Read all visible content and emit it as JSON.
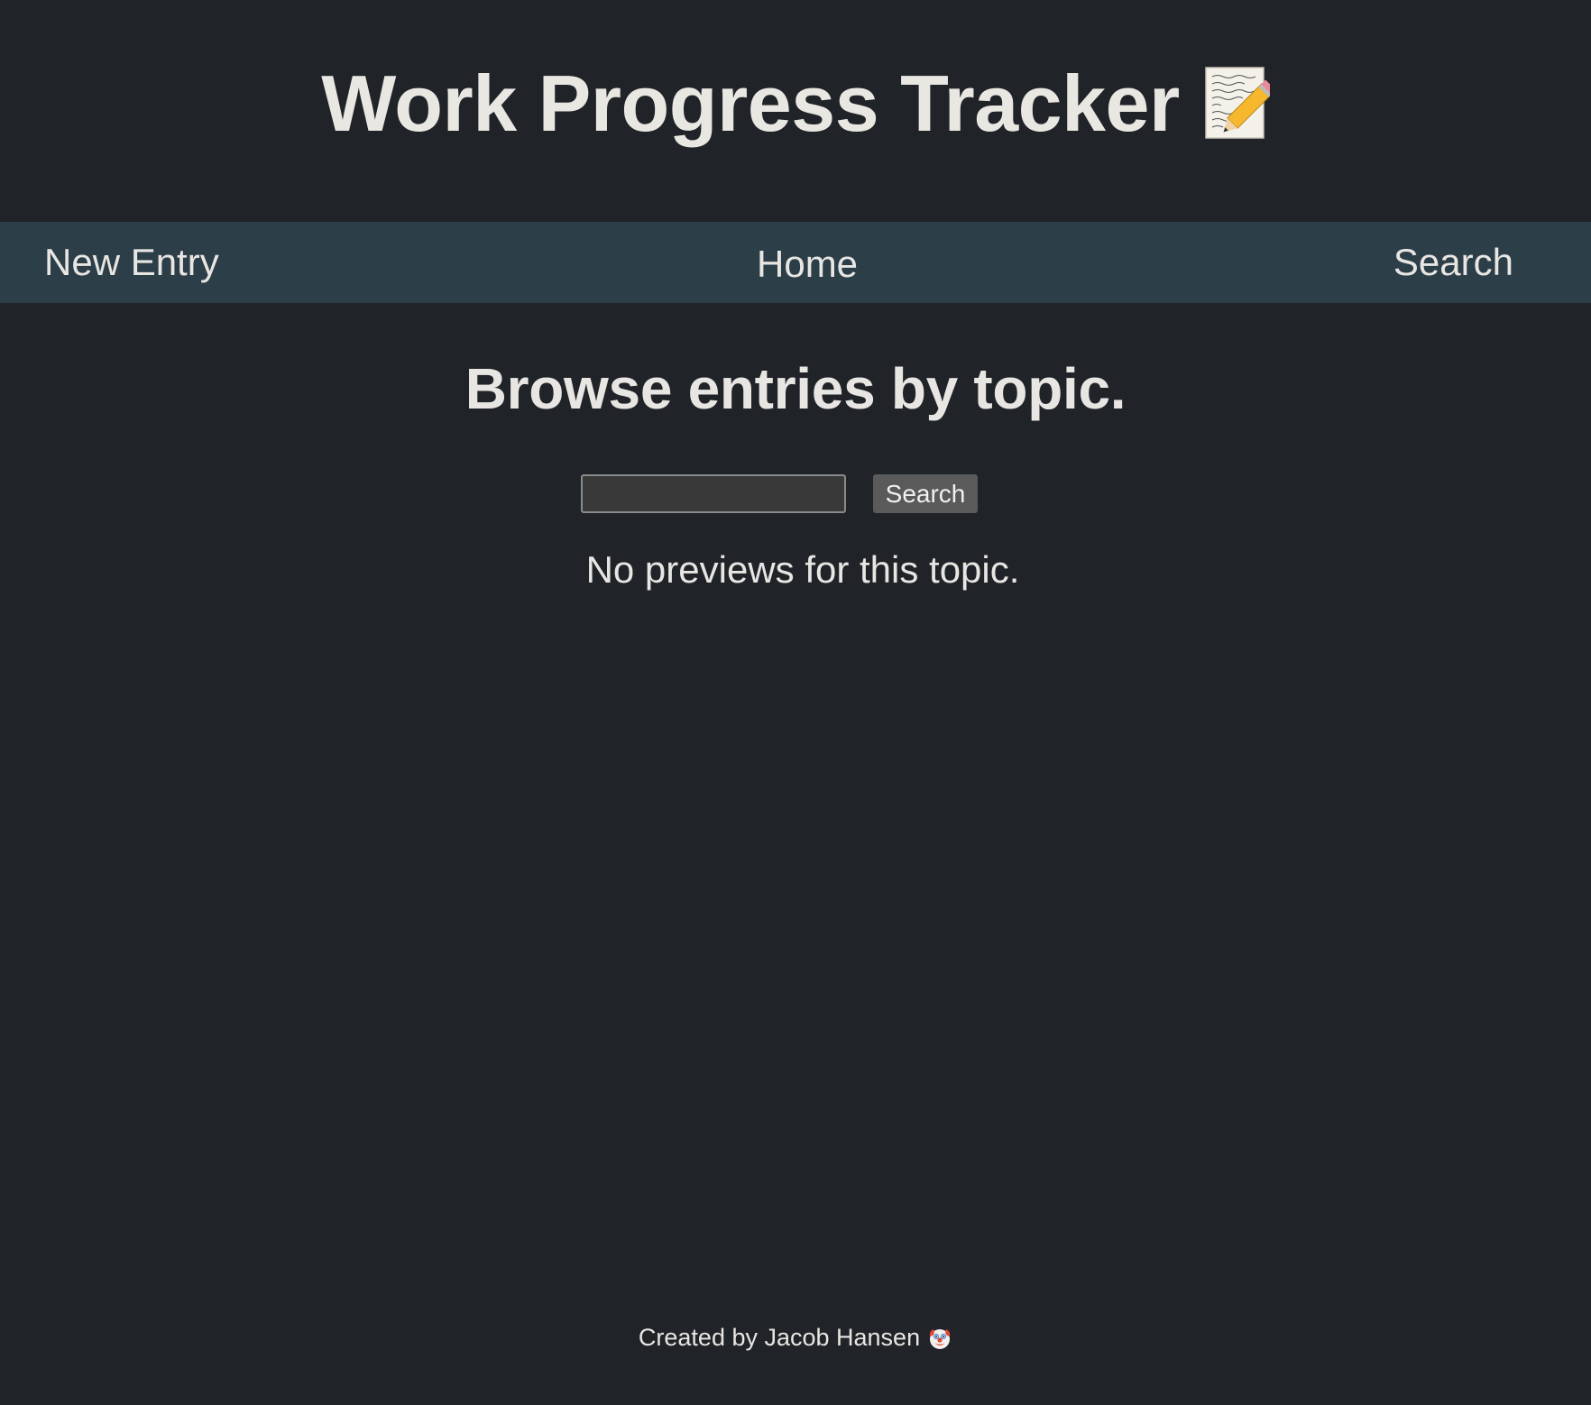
{
  "header": {
    "title": "Work Progress Tracker",
    "title_icon": "memo-icon"
  },
  "nav": {
    "items": [
      {
        "label": "New Entry"
      },
      {
        "label": "Home"
      },
      {
        "label": "Search"
      }
    ]
  },
  "main": {
    "heading": "Browse entries by topic.",
    "search": {
      "value": "",
      "placeholder": "",
      "button_label": "Search"
    },
    "empty_message": "No previews for this topic."
  },
  "footer": {
    "text": "Created by Jacob Hansen",
    "icon": "clown-face-icon"
  },
  "colors": {
    "background": "#202328",
    "navbar": "#2c3e48",
    "text": "#e8e6e3",
    "input_bg": "#393939",
    "button_bg": "#5a5a5a"
  }
}
